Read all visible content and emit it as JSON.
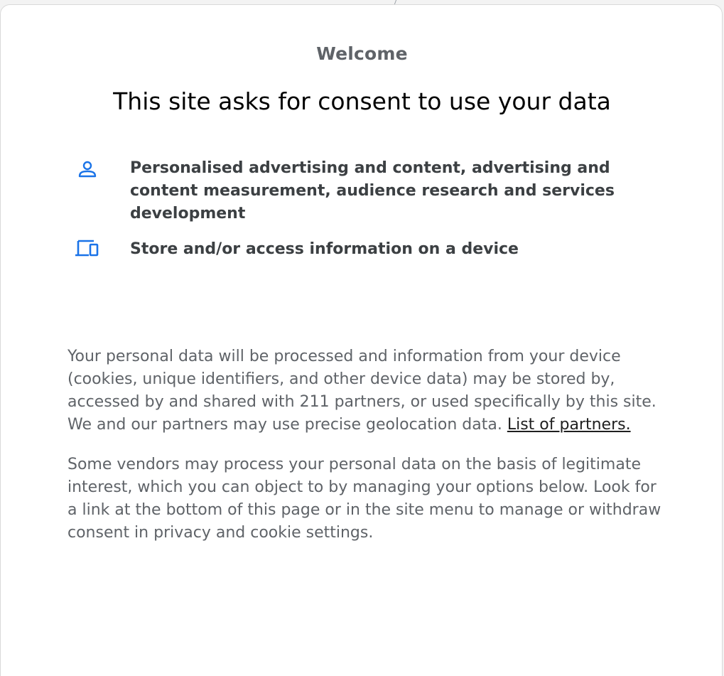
{
  "dialog": {
    "welcome": "Welcome",
    "title": "This site asks for consent to use your data",
    "purposes": [
      {
        "icon": "person-icon",
        "label": "Personalised advertising and content, advertising and content measurement, audience research and services development"
      },
      {
        "icon": "devices-icon",
        "label": "Store and/or access information on a device"
      }
    ],
    "paragraph1_text": "Your personal data will be processed and information from your device (cookies, unique identifiers, and other device data) may be stored by, accessed by and shared with 211 partners, or used specifically by this site. We and our partners may use precise geolocation data.",
    "partners_link": "List of partners.",
    "paragraph2": "Some vendors may process your personal data on the basis of legitimate interest, which you can object to by managing your options below. Look for a link at the bottom of this page or in the site menu to manage or withdraw consent in privacy and cookie settings."
  },
  "colors": {
    "accent": "#1a73e8",
    "body_text": "#5f6368",
    "title_text": "#000000"
  }
}
